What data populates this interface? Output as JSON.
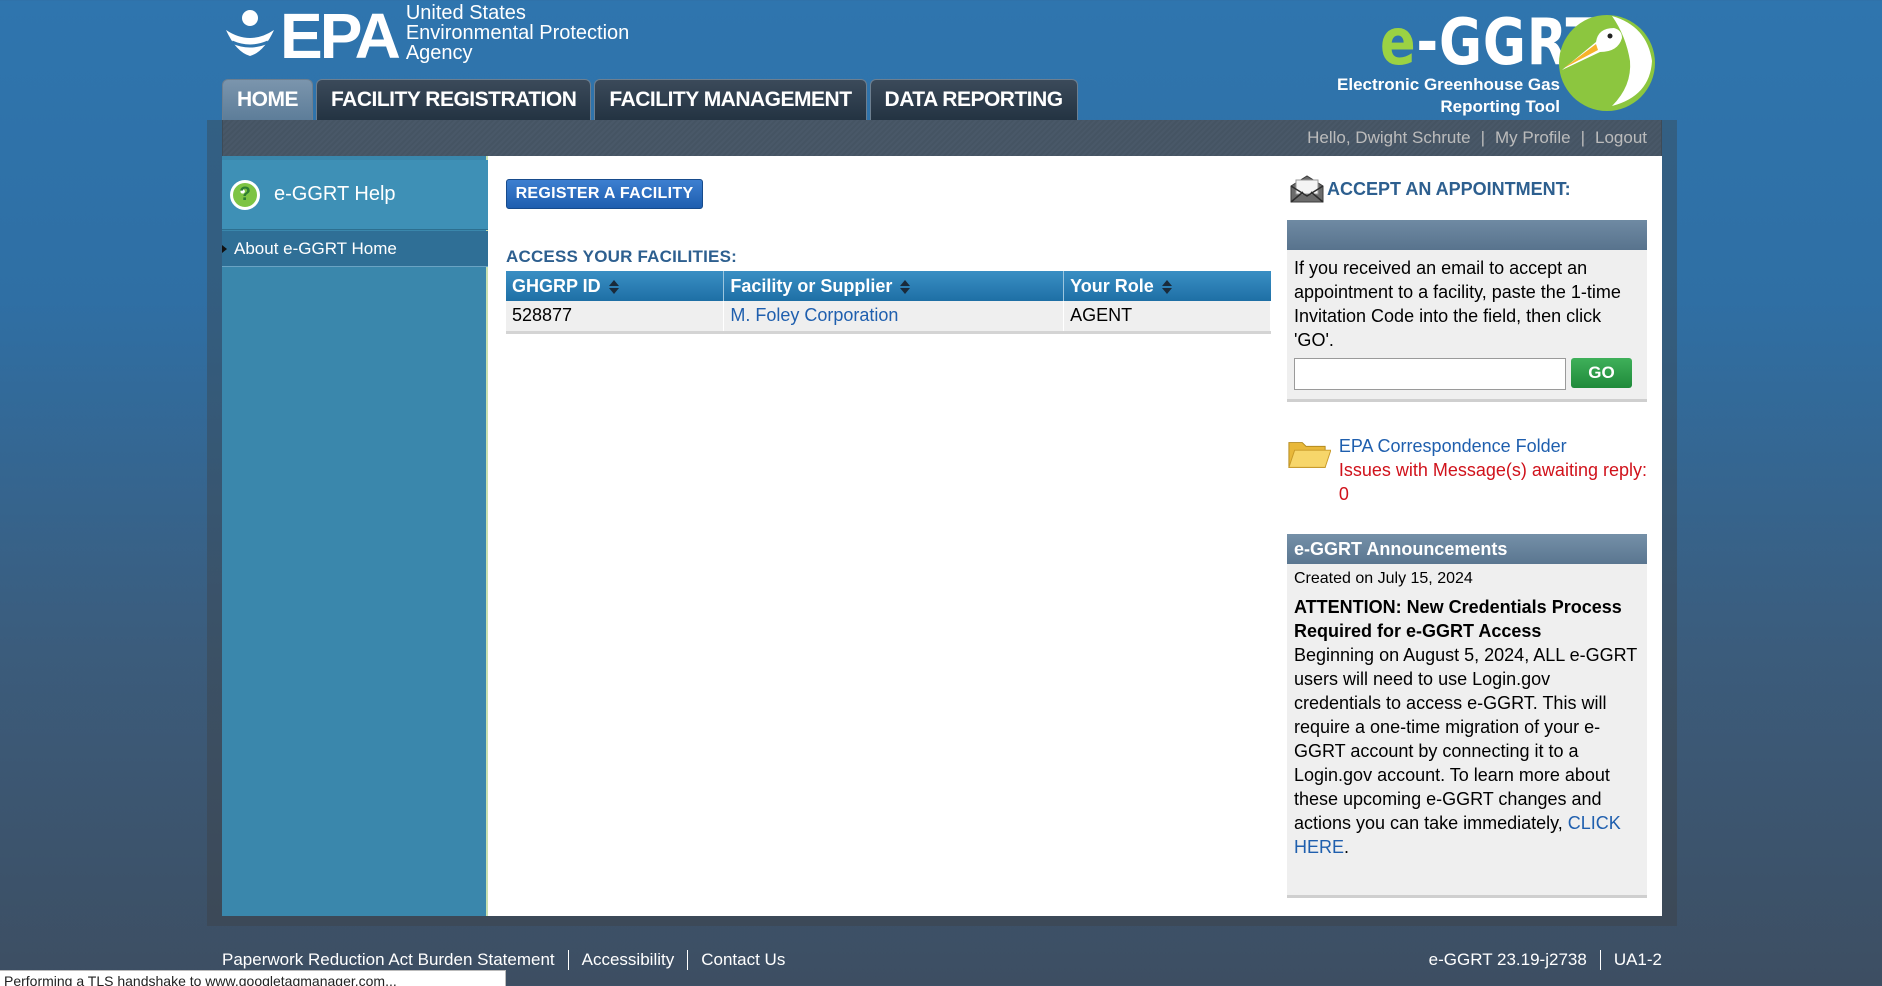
{
  "brand": {
    "epa_word": "EPA",
    "epa_sub": [
      "United States",
      "Environmental Protection",
      "Agency"
    ],
    "app_prefix": "e",
    "app_name": "-GGRT",
    "app_tagline": [
      "Electronic Greenhouse Gas",
      "Reporting Tool"
    ],
    "accent_green": "#9bd243"
  },
  "nav": {
    "tabs": [
      {
        "label": "HOME",
        "active": true
      },
      {
        "label": "FACILITY REGISTRATION",
        "active": false
      },
      {
        "label": "FACILITY MANAGEMENT",
        "active": false
      },
      {
        "label": "DATA REPORTING",
        "active": false
      }
    ]
  },
  "user_bar": {
    "greeting": "Hello, Dwight Schrute",
    "profile": "My Profile",
    "logout": "Logout"
  },
  "sidebar": {
    "help_label": "e-GGRT Help",
    "items": [
      {
        "label": "About e-GGRT Home"
      }
    ]
  },
  "main": {
    "register_button": "REGISTER A FACILITY",
    "facilities_title": "ACCESS YOUR FACILITIES:",
    "columns": [
      "GHGRP ID",
      "Facility or Supplier",
      "Your Role"
    ],
    "rows": [
      {
        "id": "528877",
        "facility": "M. Foley Corporation",
        "role": "AGENT"
      }
    ]
  },
  "appointment": {
    "title": "ACCEPT AN APPOINTMENT:",
    "instructions": "If you received an email to accept an appointment to a facility, paste the 1-time Invitation Code into the field, then click 'GO'.",
    "input_value": "",
    "go_label": "GO"
  },
  "correspondence": {
    "link": "EPA Correspondence Folder",
    "issues": "Issues with Message(s) awaiting reply: 0"
  },
  "announcements": {
    "header": "e-GGRT Announcements",
    "date": "Created on July 15, 2024",
    "title": "ATTENTION: New Credentials Process Required for e-GGRT Access",
    "body": "Beginning on August 5, 2024, ALL e-GGRT users will need to use Login.gov credentials to access e-GGRT. This will require a one-time migration of your e-GGRT account by connecting it to a Login.gov account. To learn more about these upcoming e-GGRT changes and actions you can take immediately, ",
    "link": "CLICK HERE",
    "after_link": "."
  },
  "footer": {
    "links": [
      "Paperwork Reduction Act Burden Statement",
      "Accessibility",
      "Contact Us"
    ],
    "version": "e-GGRT 23.19-j2738",
    "server": "UA1-2"
  },
  "status_bar": "Performing a TLS handshake to www.googletagmanager.com..."
}
